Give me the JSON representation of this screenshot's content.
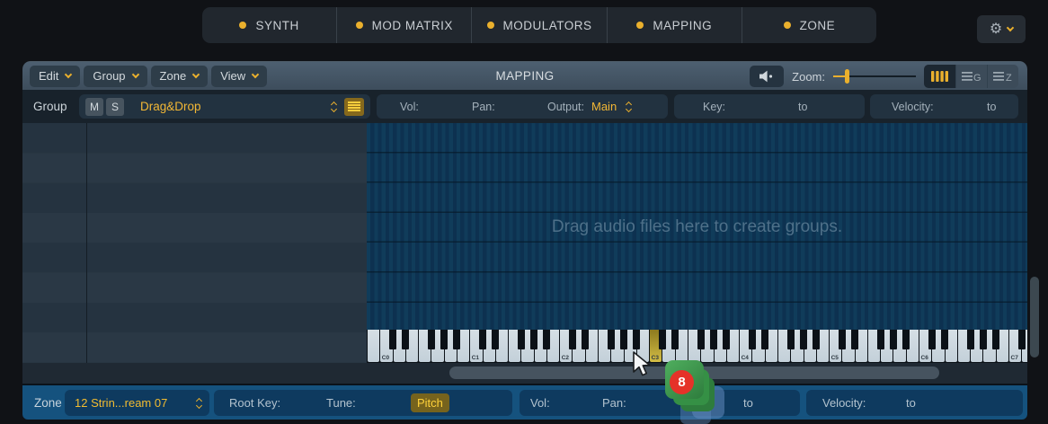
{
  "colors": {
    "accent": "#eab02d",
    "zone_blue": "#15527e",
    "panel_navy": "#0e3a5f",
    "badge_red": "#e53229"
  },
  "tabs": [
    {
      "label": "SYNTH"
    },
    {
      "label": "MOD MATRIX"
    },
    {
      "label": "MODULATORS"
    },
    {
      "label": "MAPPING"
    },
    {
      "label": "ZONE"
    }
  ],
  "menus": [
    {
      "label": "Edit"
    },
    {
      "label": "Group"
    },
    {
      "label": "Zone"
    },
    {
      "label": "View"
    }
  ],
  "header": {
    "title": "MAPPING",
    "zoom_label": "Zoom:"
  },
  "group_row": {
    "label": "Group",
    "mute": "M",
    "solo": "S",
    "name": "Drag&Drop",
    "vol": "Vol:",
    "pan": "Pan:",
    "output": "Output:",
    "output_value": "Main",
    "key": "Key:",
    "key_to": "to",
    "velocity": "Velocity:",
    "velocity_to": "to"
  },
  "main": {
    "drop_hint": "Drag audio files here to create groups."
  },
  "keyboard": {
    "octave_labels": [
      "C0",
      "C1",
      "C2",
      "C3",
      "C4",
      "C5",
      "C6",
      "C7"
    ],
    "highlighted_key": "C3"
  },
  "zone_row": {
    "label": "Zone",
    "name": "12 Strin...ream 07",
    "root_key": "Root Key:",
    "tune": "Tune:",
    "pitch": "Pitch",
    "vol": "Vol:",
    "pan": "Pan:",
    "to": "to",
    "velocity": "Velocity:",
    "velocity_to": "to"
  },
  "drag": {
    "badge_count": "8"
  }
}
